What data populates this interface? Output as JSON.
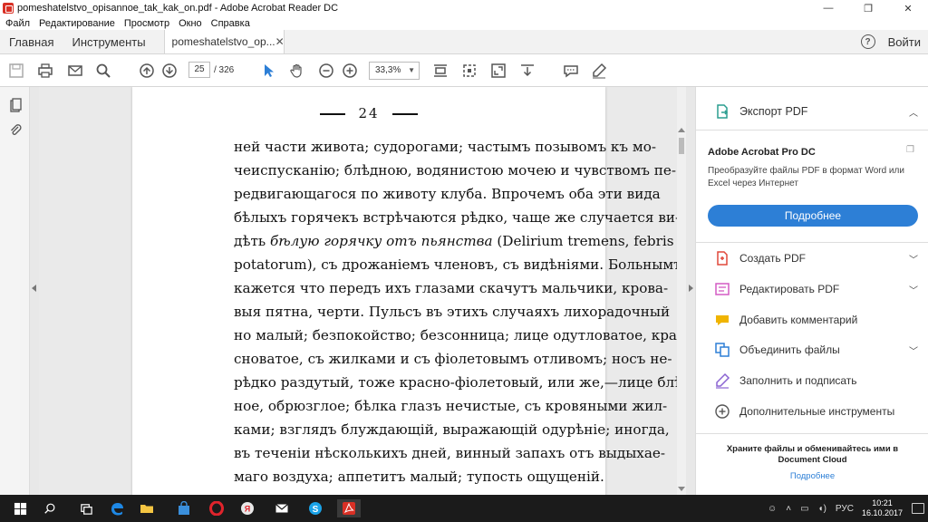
{
  "window": {
    "title": "pomeshatelstvo_opisannoe_tak_kak_on.pdf - Adobe Acrobat Reader DC",
    "minimize": "—",
    "maximize": "❐",
    "close": "✕"
  },
  "menu": [
    "Файл",
    "Редактирование",
    "Просмотр",
    "Окно",
    "Справка"
  ],
  "tabs": {
    "home": "Главная",
    "tools": "Инструменты",
    "document": "pomeshatelstvo_op...",
    "close": "✕",
    "help": "?",
    "signin": "Войти"
  },
  "toolbar": {
    "page_current": "25",
    "page_total": "/ 326",
    "zoom": "33,3%"
  },
  "document": {
    "page_number": "24",
    "lines": [
      "ней части живота; судорогами; частымъ позывомъ къ мо-",
      "чеиспусканію; блѣдною, водянистою мочею и чувствомъ пе-",
      "редвигающагося по животу клуба. Впрочемъ оба эти вида",
      "бѣлыхъ горячекъ встрѣчаются рѣдко, чаще же случается ви-",
      "potatorum), съ дрожаніемъ членовъ, съ видѣніями. Больнымъ",
      "кажется что передъ ихъ глазами скачутъ мальчики, крова-",
      "выя пятна, черти. Пульсъ въ этихъ случаяхъ лихорадочный",
      "но малый; безпокойство; безсонница; лице одутловатое, кра-",
      "сноватое, съ жилками и съ фіолетовымъ отливомъ; носъ не-",
      "рѣдко раздутый, тоже красно-фіолетовый, или же,—лице блѣд-",
      "ное, обрюзглое; бѣлка глазъ нечистые, съ кровяными жил-",
      "ками; взглядъ блуждающій, выражающій одурѣніе; иногда,",
      "въ теченіи нѣсколькихъ дней, винный запахъ отъ выдыхае-",
      "маго воздуха; аппетитъ малый; тупость ощущеній."
    ],
    "line5_plain_start": "дѣть ",
    "line5_italic": "бѣлую горячку отъ пьянства",
    "line5_plain_end": " (Delirium tremens, febris"
  },
  "right_panel": {
    "export_pdf": "Экспорт PDF",
    "product_name": "Adobe Acrobat Pro DC",
    "product_desc": "Преобразуйте файлы PDF в формат Word или Excel через Интернет",
    "more_button": "Подробнее",
    "tools": [
      {
        "label": "Создать PDF",
        "icon": "create-pdf-icon",
        "color": "#e0483b",
        "chevron": true
      },
      {
        "label": "Редактировать PDF",
        "icon": "edit-pdf-icon",
        "color": "#d45bc4",
        "chevron": true
      },
      {
        "label": "Добавить комментарий",
        "icon": "comment-icon",
        "color": "#f0b400",
        "chevron": false
      },
      {
        "label": "Объединить файлы",
        "icon": "combine-files-icon",
        "color": "#2d7fd6",
        "chevron": true
      },
      {
        "label": "Заполнить и подписать",
        "icon": "fill-sign-icon",
        "color": "#8a63d2",
        "chevron": false
      },
      {
        "label": "Дополнительные инструменты",
        "icon": "more-tools-icon",
        "color": "#555555",
        "chevron": false
      }
    ],
    "cloud_text": "Храните файлы и обменивайтесь ими в Document Cloud",
    "cloud_link": "Подробнее"
  },
  "taskbar": {
    "language": "РУС",
    "time": "10:21",
    "date": "16.10.2017"
  },
  "colors": {
    "accent": "#2d7fd6",
    "taskbar": "#1b1b1b"
  }
}
